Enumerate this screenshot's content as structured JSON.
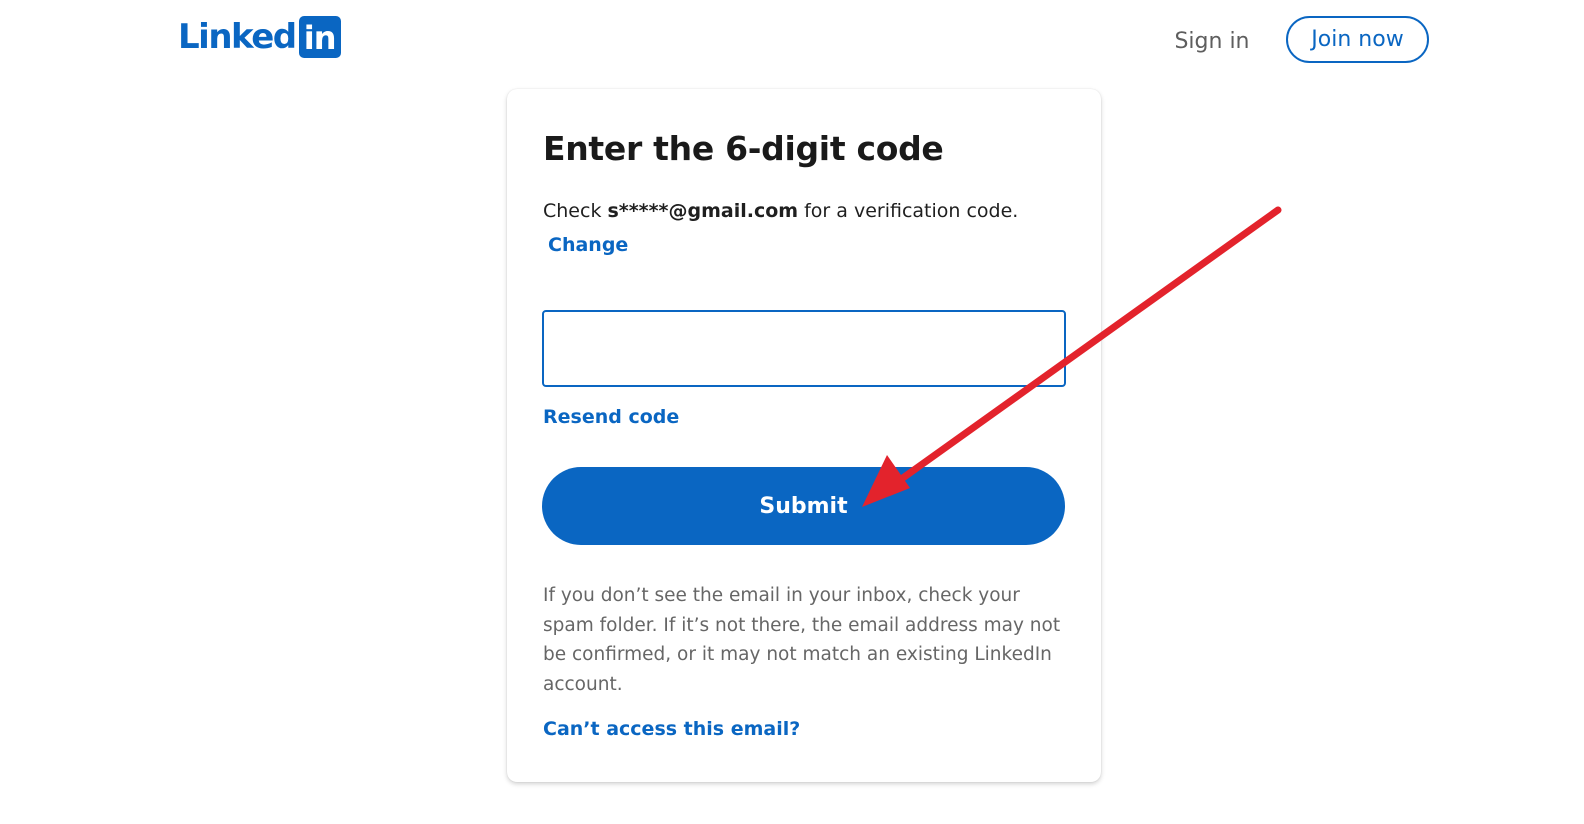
{
  "header": {
    "logo_text": "Linked",
    "logo_box_text": "in",
    "signin_label": "Sign in",
    "join_label": "Join now"
  },
  "card": {
    "title": "Enter the 6-digit code",
    "desc_prefix": "Check ",
    "desc_email": "s*****@gmail.com",
    "desc_suffix": " for a verification code.",
    "change_label": "Change",
    "code_value": "",
    "resend_label": "Resend code",
    "submit_label": "Submit",
    "help_text": "If you don’t see the email in your inbox, check your spam folder. If it’s not there, the email address may not be confirmed, or it may not match an existing LinkedIn account.",
    "cant_access_label": "Can’t access this email?"
  },
  "colors": {
    "brand": "#0a66c2",
    "annotation_arrow": "#e3232c"
  }
}
